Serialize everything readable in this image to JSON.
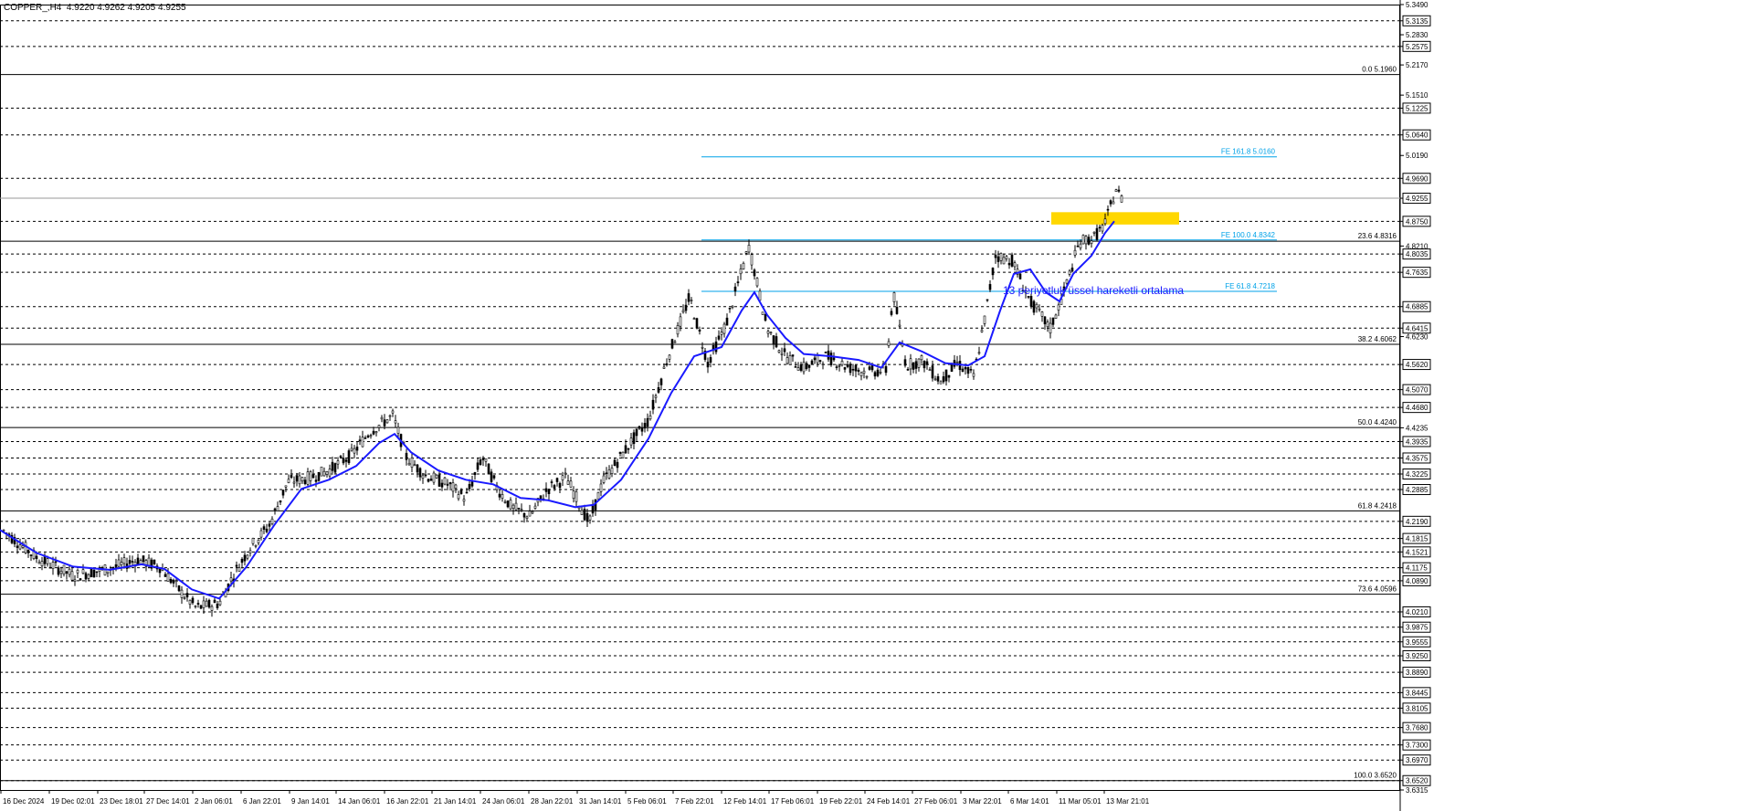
{
  "header": {
    "symbol": "COPPER_,H4",
    "ohlc": "4.9220 4.9262 4.9205 4.9255"
  },
  "annotation": "13 periyotluk üssel hareketli ortalama",
  "colors": {
    "bull_candle": "#000000",
    "bear_candle": "#000000",
    "ema": "#1a1aff",
    "fib_lines": "#000000",
    "fe_lines": "#00a2e8",
    "highlight_box": "#ffd700",
    "grid": "#000000"
  },
  "chart_data": {
    "type": "candlestick",
    "title": "",
    "ylim": [
      3.6315,
      5.349
    ],
    "y_ticks": [
      "5.3490",
      "5.3135",
      "5.2830",
      "5.2575",
      "5.2170",
      "5.1510",
      "5.1225",
      "5.0640",
      "5.0190",
      "4.9690",
      "4.9255",
      "4.8750",
      "4.8210",
      "4.8035",
      "4.7635",
      "4.6885",
      "4.6415",
      "4.6230",
      "4.5620",
      "4.5070",
      "4.4680",
      "4.4235",
      "4.3935",
      "4.3575",
      "4.3225",
      "4.2885",
      "4.2190",
      "4.1815",
      "4.1521",
      "4.1175",
      "4.0890",
      "4.0210",
      "3.9875",
      "3.9555",
      "3.9250",
      "3.8890",
      "3.8445",
      "3.8105",
      "3.7680",
      "3.7300",
      "3.6970",
      "3.6520",
      "3.6315"
    ],
    "boxed_ticks": [
      "5.3135",
      "5.2575",
      "5.1225",
      "5.0640",
      "4.9690",
      "4.9255",
      "4.8750",
      "4.8035",
      "4.7635",
      "4.6885",
      "4.6415",
      "4.5620",
      "4.5070",
      "4.4680",
      "4.3935",
      "4.3575",
      "4.3225",
      "4.2885",
      "4.2190",
      "4.1815",
      "4.1521",
      "4.1175",
      "4.0890",
      "4.0210",
      "3.9875",
      "3.9555",
      "3.9250",
      "3.8890",
      "3.8445",
      "3.8105",
      "3.7680",
      "3.7300",
      "3.6970",
      "3.6520"
    ],
    "dashed_levels": [
      5.3135,
      5.2575,
      5.1225,
      5.064,
      4.969,
      4.875,
      4.8035,
      4.7635,
      4.6885,
      4.6415,
      4.562,
      4.507,
      4.468,
      4.3935,
      4.3575,
      4.3225,
      4.2885,
      4.219,
      4.1815,
      4.1521,
      4.1175,
      4.089,
      4.021,
      3.9875,
      3.9555,
      3.925,
      3.889,
      3.8445,
      3.8105,
      3.768,
      3.73,
      3.697,
      3.652
    ],
    "x_labels": [
      "16 Dec 2024",
      "19 Dec 02:01",
      "23 Dec 18:01",
      "27 Dec 14:01",
      "2 Jan 06:01",
      "6 Jan 22:01",
      "9 Jan 14:01",
      "14 Jan 06:01",
      "16 Jan 22:01",
      "21 Jan 14:01",
      "24 Jan 06:01",
      "28 Jan 22:01",
      "31 Jan 14:01",
      "5 Feb 06:01",
      "7 Feb 22:01",
      "12 Feb 14:01",
      "17 Feb 06:01",
      "19 Feb 22:01",
      "24 Feb 14:01",
      "27 Feb 06:01",
      "3 Mar 22:01",
      "6 Mar 14:01",
      "11 Mar 05:01",
      "13 Mar 21:01"
    ],
    "fib_levels": [
      {
        "label": "0.0 5.1960",
        "value": 5.196
      },
      {
        "label": "23.6 4.8316",
        "value": 4.8316
      },
      {
        "label": "38.2 4.6062",
        "value": 4.6062
      },
      {
        "label": "50.0 4.4240",
        "value": 4.424
      },
      {
        "label": "61.8 4.2418",
        "value": 4.2418
      },
      {
        "label": "73.6 4.0596",
        "value": 4.0596
      },
      {
        "label": "100.0 3.6520",
        "value": 3.652
      }
    ],
    "fe_levels": [
      {
        "label": "FE 161.8 5.0160",
        "value": 5.016
      },
      {
        "label": "FE 100.0 4.8342",
        "value": 4.8342
      },
      {
        "label": "FE 61.8 4.7218",
        "value": 4.7218
      }
    ],
    "current_price": 4.9255,
    "highlight_zone": [
      4.868,
      4.895
    ],
    "price_path": [
      [
        0,
        4.205
      ],
      [
        40,
        4.14
      ],
      [
        80,
        4.1
      ],
      [
        120,
        4.115
      ],
      [
        150,
        4.135
      ],
      [
        175,
        4.12
      ],
      [
        200,
        4.06
      ],
      [
        215,
        4.03
      ],
      [
        240,
        4.04
      ],
      [
        258,
        4.11
      ],
      [
        275,
        4.165
      ],
      [
        295,
        4.21
      ],
      [
        315,
        4.305
      ],
      [
        340,
        4.315
      ],
      [
        360,
        4.33
      ],
      [
        385,
        4.365
      ],
      [
        405,
        4.415
      ],
      [
        430,
        4.45
      ],
      [
        445,
        4.36
      ],
      [
        465,
        4.32
      ],
      [
        490,
        4.3
      ],
      [
        510,
        4.27
      ],
      [
        528,
        4.36
      ],
      [
        545,
        4.29
      ],
      [
        560,
        4.25
      ],
      [
        580,
        4.23
      ],
      [
        600,
        4.29
      ],
      [
        620,
        4.315
      ],
      [
        645,
        4.215
      ],
      [
        660,
        4.305
      ],
      [
        690,
        4.39
      ],
      [
        710,
        4.44
      ],
      [
        730,
        4.57
      ],
      [
        755,
        4.71
      ],
      [
        775,
        4.565
      ],
      [
        795,
        4.65
      ],
      [
        820,
        4.82
      ],
      [
        840,
        4.64
      ],
      [
        860,
        4.58
      ],
      [
        880,
        4.555
      ],
      [
        905,
        4.58
      ],
      [
        930,
        4.555
      ],
      [
        950,
        4.545
      ],
      [
        970,
        4.55
      ],
      [
        978,
        4.72
      ],
      [
        992,
        4.56
      ],
      [
        1010,
        4.57
      ],
      [
        1030,
        4.525
      ],
      [
        1048,
        4.565
      ],
      [
        1066,
        4.535
      ],
      [
        1078,
        4.66
      ],
      [
        1090,
        4.8
      ],
      [
        1108,
        4.79
      ],
      [
        1128,
        4.7
      ],
      [
        1150,
        4.64
      ],
      [
        1165,
        4.72
      ],
      [
        1182,
        4.83
      ],
      [
        1198,
        4.84
      ],
      [
        1210,
        4.87
      ],
      [
        1222,
        4.945
      ],
      [
        1228,
        4.925
      ]
    ],
    "ema_path": [
      [
        0,
        4.2
      ],
      [
        40,
        4.15
      ],
      [
        80,
        4.12
      ],
      [
        120,
        4.113
      ],
      [
        155,
        4.125
      ],
      [
        180,
        4.115
      ],
      [
        210,
        4.07
      ],
      [
        240,
        4.05
      ],
      [
        270,
        4.12
      ],
      [
        300,
        4.21
      ],
      [
        330,
        4.29
      ],
      [
        360,
        4.31
      ],
      [
        390,
        4.34
      ],
      [
        415,
        4.39
      ],
      [
        432,
        4.41
      ],
      [
        450,
        4.37
      ],
      [
        480,
        4.33
      ],
      [
        510,
        4.31
      ],
      [
        540,
        4.3
      ],
      [
        570,
        4.27
      ],
      [
        600,
        4.265
      ],
      [
        630,
        4.25
      ],
      [
        650,
        4.255
      ],
      [
        680,
        4.31
      ],
      [
        710,
        4.4
      ],
      [
        735,
        4.5
      ],
      [
        760,
        4.58
      ],
      [
        790,
        4.6
      ],
      [
        812,
        4.68
      ],
      [
        826,
        4.72
      ],
      [
        840,
        4.67
      ],
      [
        860,
        4.62
      ],
      [
        880,
        4.585
      ],
      [
        910,
        4.58
      ],
      [
        940,
        4.572
      ],
      [
        965,
        4.555
      ],
      [
        985,
        4.61
      ],
      [
        1010,
        4.59
      ],
      [
        1035,
        4.565
      ],
      [
        1060,
        4.56
      ],
      [
        1078,
        4.58
      ],
      [
        1095,
        4.68
      ],
      [
        1110,
        4.76
      ],
      [
        1128,
        4.77
      ],
      [
        1145,
        4.72
      ],
      [
        1160,
        4.7
      ],
      [
        1175,
        4.76
      ],
      [
        1195,
        4.8
      ],
      [
        1210,
        4.85
      ],
      [
        1220,
        4.875
      ]
    ]
  }
}
